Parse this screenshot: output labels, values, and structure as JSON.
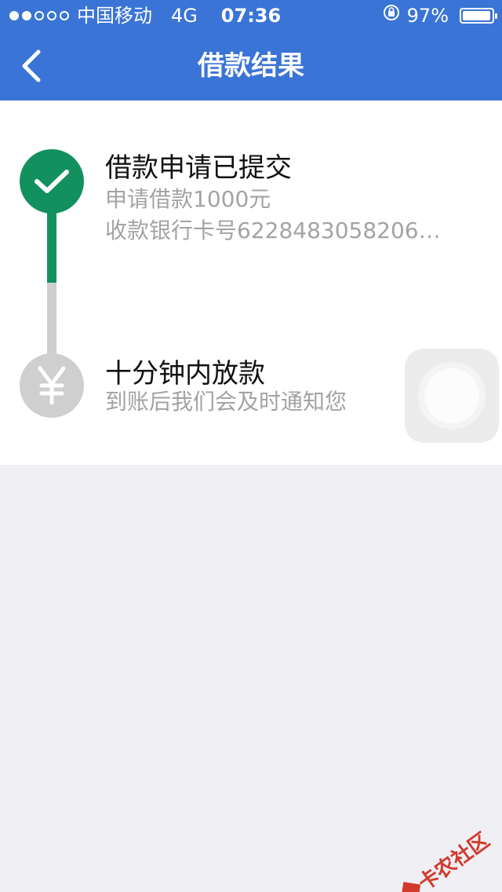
{
  "status_bar": {
    "signal_dots": [
      true,
      true,
      false,
      false,
      false
    ],
    "carrier": "中国移动",
    "network": "4G",
    "time": "07:36",
    "battery_percent": "97%",
    "battery_level": 0.97
  },
  "navbar": {
    "back_icon": "chevron-left-icon",
    "title": "借款结果"
  },
  "steps": [
    {
      "icon": "check-icon",
      "title": "借款申请已提交",
      "lines": [
        "申请借款1000元",
        "收款银行卡号6228483058206…"
      ],
      "state": "done",
      "color": "#12915f"
    },
    {
      "icon": "yen-icon",
      "title": "十分钟内放款",
      "lines": [
        "到账后我们会及时通知您"
      ],
      "state": "pending",
      "color": "#cfcfcf"
    }
  ],
  "watermark": {
    "text": "卡农社区"
  },
  "colors": {
    "header": "#3a74d6",
    "background": "#efeff4",
    "done": "#12915f",
    "pending": "#cfcfcf",
    "subtext": "#a3a3a3"
  }
}
